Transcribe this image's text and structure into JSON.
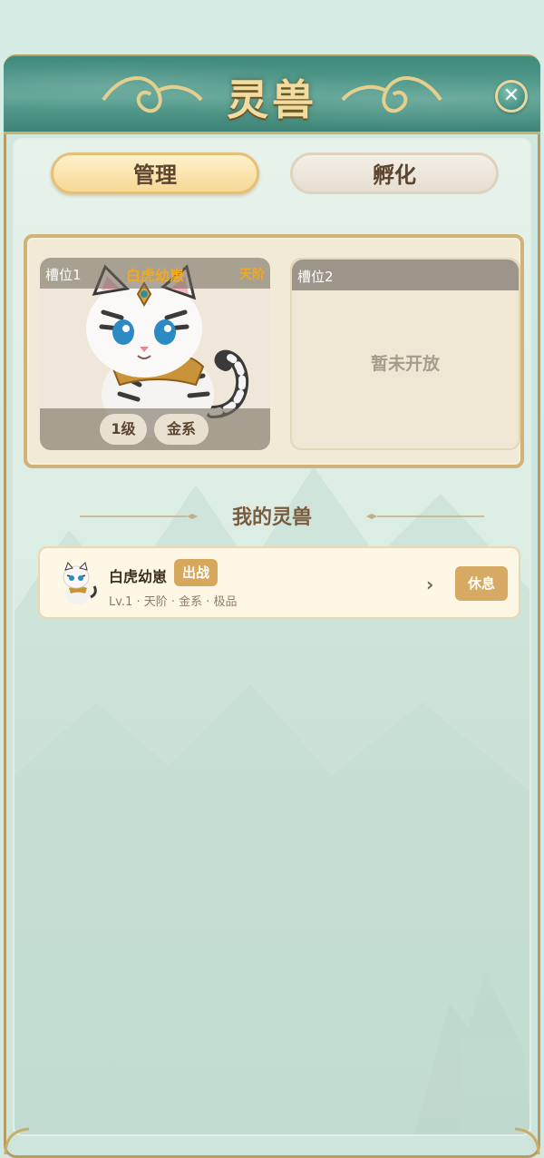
{
  "header": {
    "title": "灵兽",
    "close_icon": "close-icon"
  },
  "tabs": [
    {
      "label": "管理",
      "active": true
    },
    {
      "label": "孵化",
      "active": false
    }
  ],
  "slots": [
    {
      "label": "槽位1",
      "pet_name": "白虎幼崽",
      "grade": "天阶",
      "level": "1级",
      "element": "金系"
    },
    {
      "label": "槽位2",
      "status": "暂未开放"
    }
  ],
  "section": {
    "title": "我的灵兽"
  },
  "pet_list": [
    {
      "name": "白虎幼崽",
      "status": "出战",
      "details": "Lv.1 · 天阶 · 金系 · 极品",
      "action": "休息"
    }
  ],
  "colors": {
    "accent": "#d6a964",
    "header": "#4a9484",
    "grade": "#f2a91d"
  }
}
